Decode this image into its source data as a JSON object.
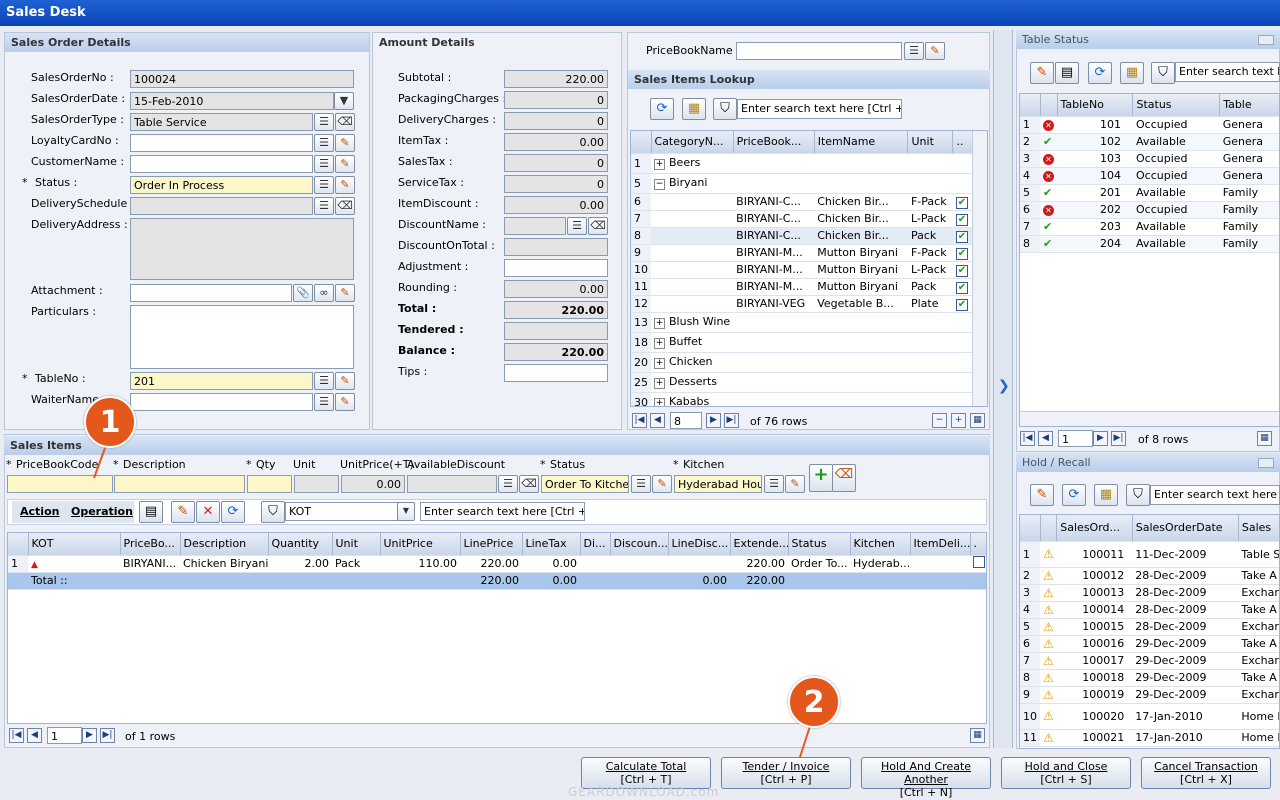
{
  "window": {
    "title": "Sales Desk"
  },
  "order": {
    "header": "Sales Order Details",
    "labels": {
      "no": "SalesOrderNo :",
      "date": "SalesOrderDate :",
      "type": "SalesOrderType :",
      "loyalty": "LoyaltyCardNo :",
      "customer": "CustomerName :",
      "status": "Status :",
      "schedule": "DeliverySchedule :",
      "address": "DeliveryAddress :",
      "attachment": "Attachment :",
      "particulars": "Particulars :",
      "tableno": "TableNo :",
      "waiter": "WaiterName :"
    },
    "values": {
      "no": "100024",
      "date": "15-Feb-2010",
      "type": "Table Service",
      "status": "Order In Process",
      "tableno": "201"
    }
  },
  "amount": {
    "header": "Amount Details",
    "rows": [
      {
        "label": "Subtotal :",
        "value": "220.00"
      },
      {
        "label": "PackagingCharges :",
        "value": "0"
      },
      {
        "label": "DeliveryCharges :",
        "value": "0"
      },
      {
        "label": "ItemTax :",
        "value": "0.00"
      },
      {
        "label": "SalesTax :",
        "value": "0"
      },
      {
        "label": "ServiceTax :",
        "value": "0"
      },
      {
        "label": "ItemDiscount :",
        "value": "0.00"
      },
      {
        "label": "DiscountName :",
        "value": ""
      },
      {
        "label": "DiscountOnTotal :",
        "value": ""
      },
      {
        "label": "Adjustment :",
        "value": ""
      },
      {
        "label": "Rounding :",
        "value": "0.00"
      },
      {
        "label": "Total :",
        "value": "220.00"
      },
      {
        "label": "Tendered :",
        "value": ""
      },
      {
        "label": "Balance :",
        "value": "220.00"
      },
      {
        "label": "Tips :",
        "value": ""
      }
    ]
  },
  "pricebook": {
    "label": "PriceBookName :"
  },
  "lookup": {
    "header": "Sales Items Lookup",
    "search_placeholder": "Enter search text here [Ctrl + F]",
    "columns": [
      "CategoryN...",
      "PriceBook...",
      "ItemName",
      "Unit",
      ".."
    ],
    "rows": [
      {
        "n": "1",
        "cat": "Beers",
        "group": true,
        "open": false
      },
      {
        "n": "5",
        "cat": "Biryani",
        "group": true,
        "open": true
      },
      {
        "n": "6",
        "pb": "BIRYANI-C...",
        "item": "Chicken Bir...",
        "unit": "F-Pack"
      },
      {
        "n": "7",
        "pb": "BIRYANI-C...",
        "item": "Chicken Bir...",
        "unit": "L-Pack"
      },
      {
        "n": "8",
        "pb": "BIRYANI-C...",
        "item": "Chicken Bir...",
        "unit": "Pack"
      },
      {
        "n": "9",
        "pb": "BIRYANI-M...",
        "item": "Mutton Biryani",
        "unit": "F-Pack"
      },
      {
        "n": "10",
        "pb": "BIRYANI-M...",
        "item": "Mutton Biryani",
        "unit": "L-Pack"
      },
      {
        "n": "11",
        "pb": "BIRYANI-M...",
        "item": "Mutton Biryani",
        "unit": "Pack"
      },
      {
        "n": "12",
        "pb": "BIRYANI-VEG",
        "item": "Vegetable B...",
        "unit": "Plate"
      },
      {
        "n": "13",
        "cat": "Blush Wine",
        "group": true,
        "open": false
      },
      {
        "n": "18",
        "cat": "Buffet",
        "group": true,
        "open": false
      },
      {
        "n": "20",
        "cat": "Chicken",
        "group": true,
        "open": false
      },
      {
        "n": "25",
        "cat": "Desserts",
        "group": true,
        "open": false
      },
      {
        "n": "30",
        "cat": "Kababs",
        "group": true,
        "open": false
      }
    ],
    "page": "8",
    "rows_text": "of 76 rows"
  },
  "table_status": {
    "header": "Table Status",
    "search_placeholder": "Enter search text here",
    "columns": [
      "TableNo",
      "Status",
      "Table"
    ],
    "rows": [
      {
        "n": "1",
        "no": "101",
        "status": "Occupied",
        "type": "Genera",
        "ok": false
      },
      {
        "n": "2",
        "no": "102",
        "status": "Available",
        "type": "Genera",
        "ok": true
      },
      {
        "n": "3",
        "no": "103",
        "status": "Occupied",
        "type": "Genera",
        "ok": false
      },
      {
        "n": "4",
        "no": "104",
        "status": "Occupied",
        "type": "Genera",
        "ok": false
      },
      {
        "n": "5",
        "no": "201",
        "status": "Available",
        "type": "Family",
        "ok": true
      },
      {
        "n": "6",
        "no": "202",
        "status": "Occupied",
        "type": "Family",
        "ok": false
      },
      {
        "n": "7",
        "no": "203",
        "status": "Available",
        "type": "Family",
        "ok": true
      },
      {
        "n": "8",
        "no": "204",
        "status": "Available",
        "type": "Family",
        "ok": true
      }
    ],
    "page": "1",
    "rows_text": "of 8 rows"
  },
  "hold": {
    "header": "Hold / Recall",
    "search_placeholder": "Enter search text here [C",
    "columns": [
      "SalesOrd...",
      "SalesOrderDate",
      "Sales"
    ],
    "rows": [
      {
        "n": "1",
        "no": "100011",
        "date": "11-Dec-2009",
        "type": "Table S"
      },
      {
        "n": "2",
        "no": "100012",
        "date": "28-Dec-2009",
        "type": "Take A"
      },
      {
        "n": "3",
        "no": "100013",
        "date": "28-Dec-2009",
        "type": "Exchar"
      },
      {
        "n": "4",
        "no": "100014",
        "date": "28-Dec-2009",
        "type": "Take A"
      },
      {
        "n": "5",
        "no": "100015",
        "date": "28-Dec-2009",
        "type": "Exchar"
      },
      {
        "n": "6",
        "no": "100016",
        "date": "29-Dec-2009",
        "type": "Take A"
      },
      {
        "n": "7",
        "no": "100017",
        "date": "29-Dec-2009",
        "type": "Exchar"
      },
      {
        "n": "8",
        "no": "100018",
        "date": "29-Dec-2009",
        "type": "Take A"
      },
      {
        "n": "9",
        "no": "100019",
        "date": "29-Dec-2009",
        "type": "Exchar"
      },
      {
        "n": "10",
        "no": "100020",
        "date": "17-Jan-2010",
        "type": "Home I"
      },
      {
        "n": "11",
        "no": "100021",
        "date": "17-Jan-2010",
        "type": "Home I"
      }
    ]
  },
  "items": {
    "header": "Sales Items",
    "entry_labels": {
      "pbc": "PriceBookCode",
      "desc": "Description",
      "qty": "Qty",
      "unit": "Unit",
      "price": "UnitPrice(+T)",
      "disc": "AvailableDiscount",
      "status": "Status",
      "kitchen": "Kitchen"
    },
    "entry_values": {
      "price": "0.00",
      "status": "Order To Kitchen",
      "kitchen": "Hyderabad Hous"
    },
    "action": "Action",
    "operation": "Operation",
    "filter_value": "KOT",
    "search_placeholder": "Enter search text here [Ctrl + F]",
    "columns": [
      "KOT",
      "PriceBo...",
      "Description",
      "Quantity",
      "Unit",
      "UnitPrice",
      "LinePrice",
      "LineTax",
      "Di...",
      "Discoun...",
      "LineDisc...",
      "Extende...",
      "Status",
      "Kitchen",
      "ItemDeli...",
      "."
    ],
    "row": {
      "n": "1",
      "pb": "BIRYANI...",
      "desc": "Chicken Biryani",
      "qty": "2.00",
      "unit": "Pack",
      "price": "110.00",
      "line": "220.00",
      "tax": "0.00",
      "ext": "220.00",
      "status": "Order To...",
      "kitchen": "Hyderab..."
    },
    "total": {
      "label": "Total ::",
      "line": "220.00",
      "tax": "0.00",
      "linedisc": "0.00",
      "ext": "220.00"
    },
    "page": "1",
    "rows_text": "of 1 rows"
  },
  "buttons": [
    {
      "line1": "Calculate Total",
      "line2": "[Ctrl + T]"
    },
    {
      "line1": "Tender / Invoice",
      "line2": "[Ctrl + P]"
    },
    {
      "line1": "Hold And Create Another",
      "line2": "[Ctrl + N]"
    },
    {
      "line1": "Hold and Close",
      "line2": "[Ctrl + S]"
    },
    {
      "line1": "Cancel Transaction",
      "line2": "[Ctrl + X]"
    }
  ],
  "markers": {
    "one": "1",
    "two": "2"
  },
  "watermark": "GEARDOWNLOAD.com",
  "required_mark": "*"
}
